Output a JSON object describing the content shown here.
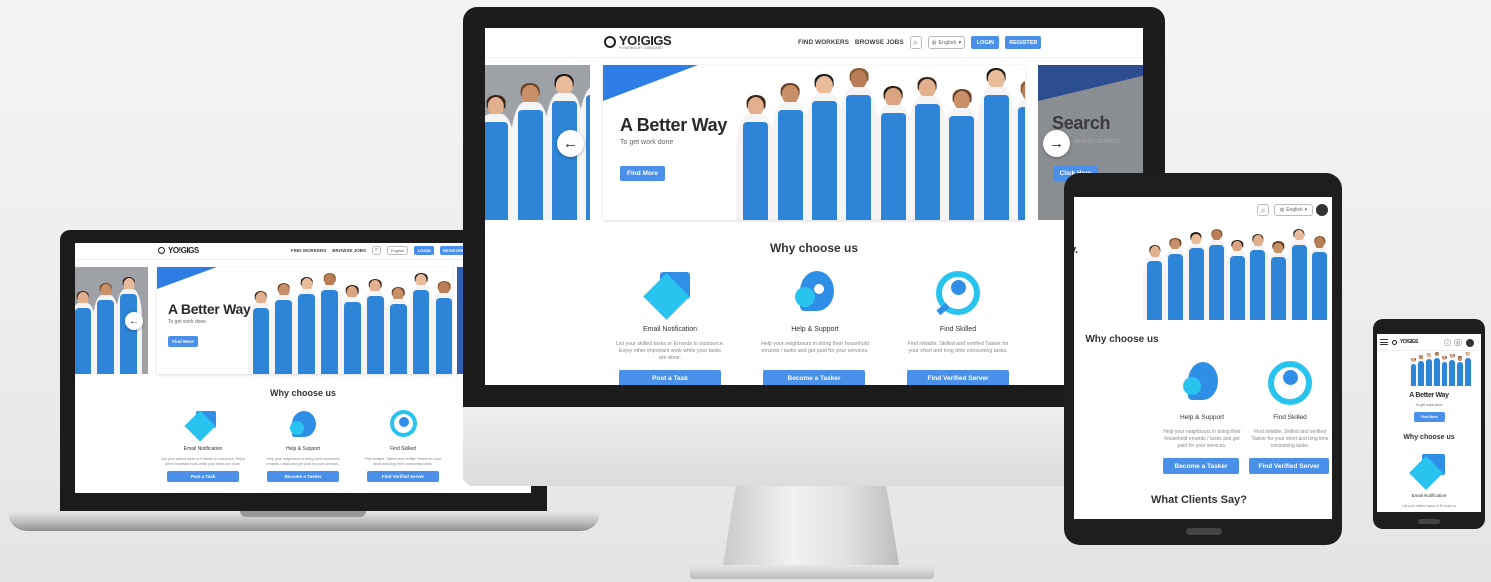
{
  "brand": {
    "logo": "YO!GIGS",
    "tagline": "POWERED BY JOBBOARD"
  },
  "nav": {
    "find_workers": "FIND WORKERS",
    "browse_jobs": "BROWSE JOBS",
    "language": "English",
    "login": "LOGIN",
    "register": "REGISTER"
  },
  "hero": {
    "title": "A Better Way",
    "subtitle": "To get work done",
    "cta": "Find More",
    "next_title": "Search",
    "next_subtitle": "search taskers",
    "next_cta": "Click Here"
  },
  "why": {
    "heading": "Why choose us",
    "features": [
      {
        "title": "Email Notification",
        "desc": "List your skilled tasks or Errands to outsource. Enjoy other important work while your tasks are done.",
        "button": "Post a Task",
        "icon": "email-notification-icon"
      },
      {
        "title": "Help & Support",
        "desc": "Help your neighbours in doing their household errands / tasks and get paid for your services.",
        "button": "Become a Tasker",
        "icon": "help-support-icon"
      },
      {
        "title": "Find Skilled",
        "desc": "Find reliable, Skilled and verified Tasker for your short and long time consuming tasks.",
        "button": "Find Verified Server",
        "icon": "find-skilled-icon"
      }
    ]
  },
  "clients": {
    "heading": "What Clients Say?"
  },
  "mobile": {
    "feature_desc": "List your skilled tasks or Errands to"
  },
  "colors": {
    "accent": "#4a90e8",
    "cyan": "#29c3f0",
    "brand_blue": "#2f7ee6"
  }
}
